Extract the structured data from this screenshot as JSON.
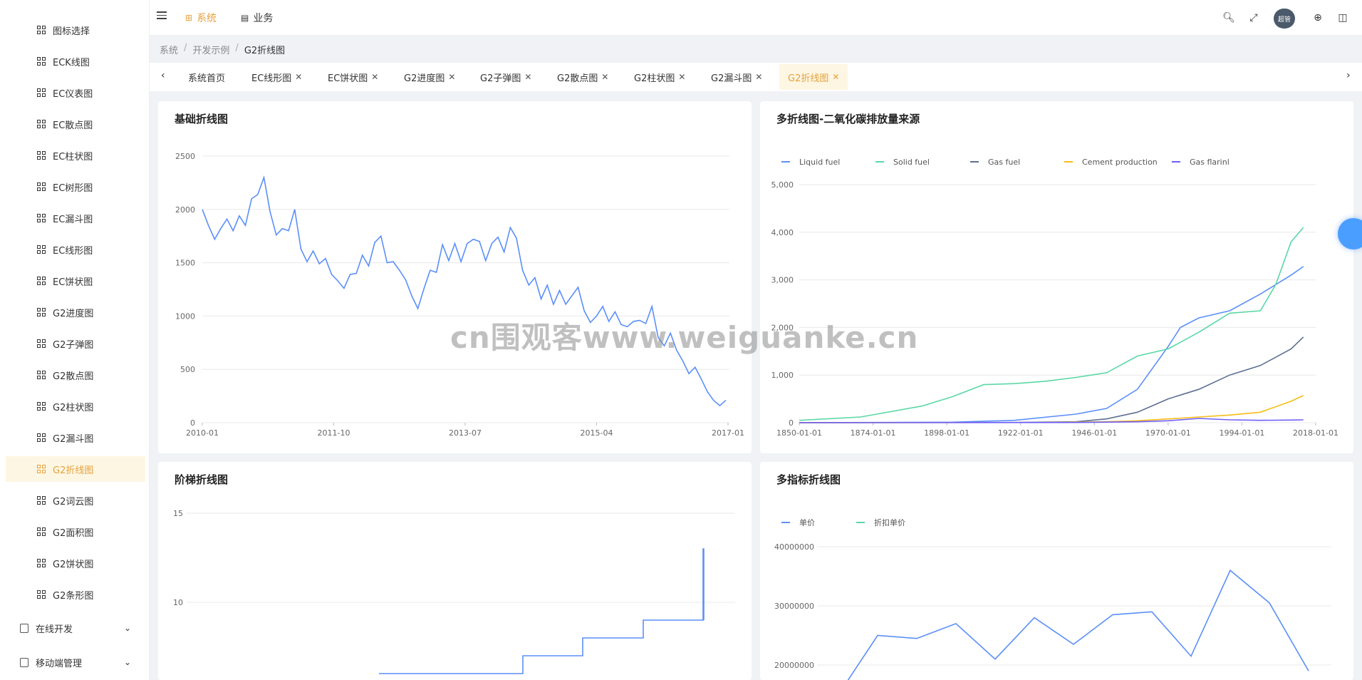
{
  "sidebar": {
    "items": [
      {
        "label": "图标选择",
        "active": false
      },
      {
        "label": "ECK线图",
        "active": false
      },
      {
        "label": "EC仪表图",
        "active": false
      },
      {
        "label": "EC散点图",
        "active": false
      },
      {
        "label": "EC柱状图",
        "active": false
      },
      {
        "label": "EC树形图",
        "active": false
      },
      {
        "label": "EC漏斗图",
        "active": false
      },
      {
        "label": "EC线形图",
        "active": false
      },
      {
        "label": "EC饼状图",
        "active": false
      },
      {
        "label": "G2进度图",
        "active": false
      },
      {
        "label": "G2子弹图",
        "active": false
      },
      {
        "label": "G2散点图",
        "active": false
      },
      {
        "label": "G2柱状图",
        "active": false
      },
      {
        "label": "G2漏斗图",
        "active": false
      },
      {
        "label": "G2折线图",
        "active": true
      },
      {
        "label": "G2词云图",
        "active": false
      },
      {
        "label": "G2面积图",
        "active": false
      },
      {
        "label": "G2饼状图",
        "active": false
      },
      {
        "label": "G2条形图",
        "active": false
      }
    ],
    "groups": [
      {
        "label": "在线开发"
      },
      {
        "label": "移动端管理"
      }
    ]
  },
  "header": {
    "nav": [
      {
        "label": "系统",
        "active": true
      },
      {
        "label": "业务",
        "active": false
      }
    ],
    "avatar_text": "超管"
  },
  "breadcrumb": [
    "系统",
    "开发示例",
    "G2折线图"
  ],
  "tabs": [
    {
      "label": "系统首页",
      "closable": false
    },
    {
      "label": "EC线形图",
      "closable": true
    },
    {
      "label": "EC饼状图",
      "closable": true
    },
    {
      "label": "G2进度图",
      "closable": true
    },
    {
      "label": "G2子弹图",
      "closable": true
    },
    {
      "label": "G2散点图",
      "closable": true
    },
    {
      "label": "G2柱状图",
      "closable": true
    },
    {
      "label": "G2漏斗图",
      "closable": true
    },
    {
      "label": "G2折线图",
      "closable": true,
      "active": true
    }
  ],
  "watermark": "cn围观客www.weiguanke.cn",
  "colors": {
    "accent": "#e6a23c",
    "line_blue": "#5b8ff9",
    "line_green": "#5ad8a6",
    "line_gray": "#5d7092",
    "line_yellow": "#f6bd16",
    "line_purple": "#6f5ef9"
  },
  "cards": {
    "basic": {
      "title": "基础折线图"
    },
    "multi": {
      "title": "多折线图-二氧化碳排放量来源"
    },
    "step": {
      "title": "阶梯折线图"
    },
    "metric": {
      "title": "多指标折线图"
    }
  },
  "chart_data": [
    {
      "type": "line",
      "title": "基础折线图",
      "x_ticks": [
        "2010-01",
        "2011-10",
        "2013-07",
        "2015-04",
        "2017-01"
      ],
      "y_ticks": [
        "0",
        "500",
        "1000",
        "1500",
        "2000",
        "2500"
      ],
      "ylim": [
        0,
        2500
      ],
      "series": [
        {
          "values": [
            2000,
            1850,
            1720,
            1820,
            1910,
            1800,
            1940,
            1850,
            2100,
            2140,
            2300,
            1980,
            1760,
            1820,
            1800,
            2000,
            1630,
            1510,
            1610,
            1490,
            1540,
            1390,
            1330,
            1260,
            1390,
            1400,
            1570,
            1470,
            1690,
            1750,
            1500,
            1510,
            1430,
            1340,
            1190,
            1070,
            1260,
            1430,
            1410,
            1670,
            1520,
            1680,
            1510,
            1680,
            1720,
            1700,
            1520,
            1680,
            1740,
            1600,
            1830,
            1730,
            1430,
            1290,
            1360,
            1160,
            1290,
            1110,
            1240,
            1110,
            1190,
            1270,
            1050,
            940,
            1000,
            1090,
            950,
            1040,
            920,
            900,
            950,
            960,
            930,
            1090,
            800,
            720,
            840,
            680,
            580,
            460,
            520,
            410,
            290,
            210,
            160,
            210
          ]
        }
      ],
      "grid": true
    },
    {
      "type": "line",
      "title": "多折线图-二氧化碳排放量来源",
      "x_ticks": [
        "1850-01-01",
        "1874-01-01",
        "1898-01-01",
        "1922-01-01",
        "1946-01-01",
        "1970-01-01",
        "1994-01-01",
        "2018-01-01"
      ],
      "y_ticks": [
        "0",
        "1,000",
        "2,000",
        "3,000",
        "4,000",
        "5,000"
      ],
      "ylim": [
        0,
        5000
      ],
      "legend": "top-left",
      "series": [
        {
          "name": "Liquid fuel",
          "x": [
            1850,
            1900,
            1920,
            1940,
            1950,
            1960,
            1970,
            1974,
            1980,
            1990,
            2000,
            2010,
            2014
          ],
          "values": [
            0,
            10,
            50,
            180,
            300,
            700,
            1600,
            2000,
            2200,
            2350,
            2700,
            3100,
            3280
          ]
        },
        {
          "name": "Solid fuel",
          "x": [
            1850,
            1870,
            1890,
            1900,
            1910,
            1920,
            1930,
            1940,
            1950,
            1960,
            1970,
            1980,
            1990,
            2000,
            2005,
            2010,
            2014
          ],
          "values": [
            50,
            120,
            350,
            550,
            800,
            820,
            870,
            950,
            1050,
            1400,
            1550,
            1900,
            2300,
            2350,
            2900,
            3800,
            4100
          ]
        },
        {
          "name": "Gas fuel",
          "x": [
            1850,
            1920,
            1940,
            1950,
            1960,
            1970,
            1980,
            1990,
            2000,
            2010,
            2014
          ],
          "values": [
            0,
            5,
            20,
            80,
            220,
            500,
            700,
            1000,
            1200,
            1550,
            1800
          ]
        },
        {
          "name": "Cement production",
          "x": [
            1850,
            1930,
            1950,
            1960,
            1970,
            1980,
            1990,
            2000,
            2010,
            2014
          ],
          "values": [
            0,
            5,
            20,
            40,
            80,
            120,
            160,
            220,
            450,
            570
          ]
        },
        {
          "name": "Gas flarinl",
          "x": [
            1850,
            1940,
            1960,
            1970,
            1980,
            1990,
            2000,
            2010,
            2014
          ],
          "values": [
            0,
            5,
            20,
            40,
            90,
            60,
            50,
            55,
            60
          ]
        }
      ],
      "grid": true
    },
    {
      "type": "line",
      "title": "阶梯折线图",
      "y_ticks": [
        "10",
        "15"
      ],
      "series": [
        {
          "values": [
            6,
            6,
            7,
            8,
            9,
            13,
            9
          ]
        }
      ],
      "grid": true
    },
    {
      "type": "line",
      "title": "多指标折线图",
      "y_ticks": [
        "20000000",
        "30000000",
        "40000000"
      ],
      "legend": "top-left",
      "series": [
        {
          "name": "单价",
          "values": [
            15000000,
            25000000,
            24500000,
            27000000,
            21000000,
            28000000,
            23500000,
            28500000,
            29000000,
            21500000,
            36000000,
            30500000,
            19000000
          ]
        },
        {
          "name": "折扣单价",
          "values": []
        }
      ],
      "grid": true
    }
  ]
}
